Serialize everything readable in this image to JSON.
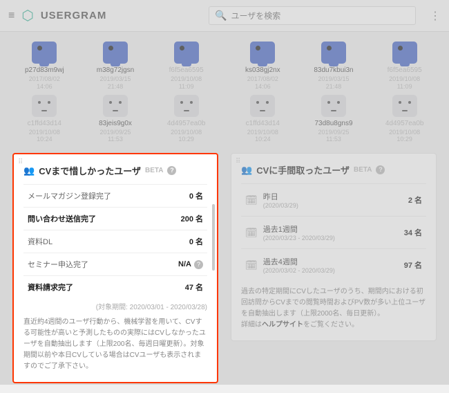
{
  "header": {
    "brand": "USERGRAM",
    "search_placeholder": "ユーザを検索"
  },
  "left_users": [
    {
      "name": "p27d83m9wj",
      "date": "2017/08/02\n14:06",
      "icon": "device",
      "gray": false
    },
    {
      "name": "m38g72jgsn",
      "date": "2019/03/15\n21:48",
      "icon": "device",
      "gray": false
    },
    {
      "name": "f6f5ea6595",
      "date": "2019/10/08\n11:09",
      "icon": "device",
      "gray": true
    },
    {
      "name": "c1ffd43d14",
      "date": "2019/10/08\n10:24",
      "icon": "face",
      "gray": true
    },
    {
      "name": "83jeis9g0x",
      "date": "2019/09/25\n11:53",
      "icon": "face",
      "gray": false
    },
    {
      "name": "4d4957ea0b",
      "date": "2019/10/08\n10:29",
      "icon": "face",
      "gray": true
    }
  ],
  "right_users": [
    {
      "name": "ks038gj2nx",
      "date": "2017/08/02\n14:06",
      "icon": "device",
      "gray": false
    },
    {
      "name": "83du7kbui3n",
      "date": "2019/03/15\n21:48",
      "icon": "device",
      "gray": false
    },
    {
      "name": "f6f5ea6595",
      "date": "2019/10/08\n11:09",
      "icon": "device",
      "gray": true
    },
    {
      "name": "c1ffd43d14",
      "date": "2019/10/08\n10:24",
      "icon": "face",
      "gray": true
    },
    {
      "name": "73d8u8gns9",
      "date": "2019/09/25\n11:53",
      "icon": "face",
      "gray": false
    },
    {
      "name": "4d4957ea0b",
      "date": "2019/10/08\n10:29",
      "icon": "face",
      "gray": true
    }
  ],
  "near_cv": {
    "title": "CVまで惜しかったユーザ",
    "beta": "BETA",
    "rows": [
      {
        "label": "メールマガジン登録完了",
        "value": "0 名",
        "active": false
      },
      {
        "label": "問い合わせ送信完了",
        "value": "200 名",
        "active": true
      },
      {
        "label": "資料DL",
        "value": "0 名",
        "active": false
      },
      {
        "label": "セミナー申込完了",
        "value": "N/A",
        "active": false,
        "help": true
      },
      {
        "label": "資料請求完了",
        "value": "47 名",
        "active": true
      }
    ],
    "period": "(対象期間: 2020/03/01 - 2020/03/28)",
    "desc": "直近約4週間のユーザ行動から、機械学習を用いて、CVする可能性が高いと予測したものの実際にはCVしなかったユーザを自動抽出します（上限200名、毎週日曜更新）。対象期間以前や本日CVしている場合はCVユーザも表示されますのでご了承下さい。"
  },
  "slow_cv": {
    "title": "CVに手間取ったユーザ",
    "beta": "BETA",
    "rows": [
      {
        "label": "昨日",
        "sub": "(2020/03/29)",
        "value": "2 名"
      },
      {
        "label": "過去1週間",
        "sub": "(2020/03/23 - 2020/03/29)",
        "value": "34 名"
      },
      {
        "label": "過去4週間",
        "sub": "(2020/03/02 - 2020/03/29)",
        "value": "97 名"
      }
    ],
    "desc": "過去の特定期間にCVしたユーザのうち、期間内における初回訪問からCVまでの閲覧時間およびPV数が多い上位ユーザを自動抽出します（上限2000名、毎日更新）。",
    "desc_suffix": "詳細は",
    "help_link": "ヘルプサイト",
    "desc_end": "をご覧ください。"
  }
}
